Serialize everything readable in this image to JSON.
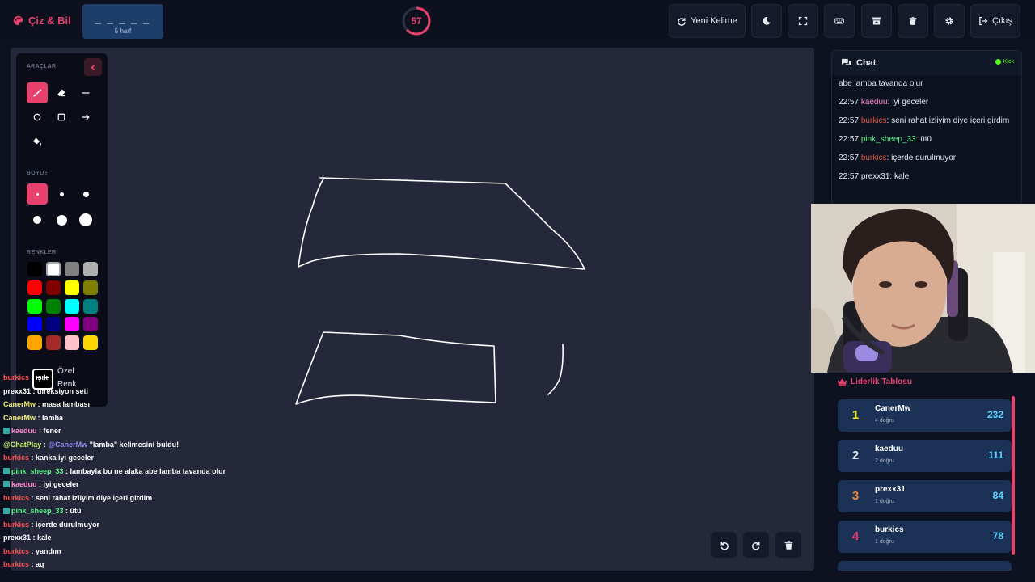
{
  "header": {
    "brand": "Çiz & Bil",
    "word_mask": "_ _ _ _ _",
    "word_length": "5 harf",
    "timer": "57",
    "timer_fraction": 0.63,
    "new_word_label": "Yeni Kelime",
    "exit_label": "Çıkış"
  },
  "tools": {
    "tools_title": "ARAÇLAR",
    "size_title": "BOYUT",
    "colors_title": "RENKLER",
    "custom_color_label_1": "Özel",
    "custom_color_label_2": "Renk",
    "colors": [
      "#000000",
      "#ffffff",
      "#808080",
      "#b0b0b0",
      "#ff0000",
      "#800000",
      "#ffff00",
      "#808000",
      "#00ff00",
      "#008000",
      "#00ffff",
      "#008080",
      "#0000ff",
      "#000080",
      "#ff00ff",
      "#800080",
      "#ffa500",
      "#a52a2a",
      "#ffc0cb",
      "#ffd700"
    ],
    "accent": "#e8416d"
  },
  "overlay_chat": [
    {
      "user": "burkics",
      "color": "#ff4d4d",
      "text": "ışık",
      "badge": false
    },
    {
      "user": "prexx31",
      "color": "#ffffff",
      "text": "direksiyon seti",
      "badge": false
    },
    {
      "user": "CanerMw",
      "color": "#f0f07a",
      "text": "masa lambası",
      "badge": false
    },
    {
      "user": "CanerMw",
      "color": "#f0f07a",
      "text": "lamba",
      "badge": false
    },
    {
      "user": "kaeduu",
      "color": "#ff8ad0",
      "text": "fener",
      "badge": true
    },
    {
      "user": "@ChatPlay",
      "color": "#c6f36b",
      "text": "\"lamba\" kelimesini buldu!",
      "mention": "@CanerMw",
      "badge": false
    },
    {
      "user": "burkics",
      "color": "#ff4d4d",
      "text": "kanka iyi geceler",
      "badge": false
    },
    {
      "user": "pink_sheep_33",
      "color": "#5df08a",
      "text": "lambayla bu ne alaka abe lamba tavanda olur",
      "badge": true
    },
    {
      "user": "kaeduu",
      "color": "#ff8ad0",
      "text": "iyi geceler",
      "badge": true
    },
    {
      "user": "burkics",
      "color": "#ff4d4d",
      "text": "seni rahat izliyim diye içeri girdim",
      "badge": false
    },
    {
      "user": "pink_sheep_33",
      "color": "#5df08a",
      "text": "ütü",
      "badge": true
    },
    {
      "user": "burkics",
      "color": "#ff4d4d",
      "text": "içerde durulmuyor",
      "badge": false
    },
    {
      "user": "prexx31",
      "color": "#ffffff",
      "text": "kale",
      "badge": false
    },
    {
      "user": "burkics",
      "color": "#ff4d4d",
      "text": "yandım",
      "badge": false
    },
    {
      "user": "burkics",
      "color": "#ff4d4d",
      "text": "aq",
      "badge": false
    }
  ],
  "chat": {
    "title": "Chat",
    "platform": "Kick",
    "partial_line": "abe lamba tavanda olur",
    "messages": [
      {
        "time": "22:57",
        "user": "kaeduu",
        "color": "#ff8ad0",
        "text": "iyi geceler"
      },
      {
        "time": "22:57",
        "user": "burkics",
        "color": "#e0533d",
        "text": "seni rahat izliyim diye içeri girdim"
      },
      {
        "time": "22:57",
        "user": "pink_sheep_33",
        "color": "#5df08a",
        "text": "ütü"
      },
      {
        "time": "22:57",
        "user": "burkics",
        "color": "#e0533d",
        "text": "içerde durulmuyor"
      },
      {
        "time": "22:57",
        "user": "prexx31",
        "color": "#e8ebf2",
        "text": "kale"
      }
    ]
  },
  "leaderboard": {
    "title": "Liderlik Tablosu",
    "rows": [
      {
        "rank": "1",
        "rank_color": "#f5e21e",
        "name": "CanerMw",
        "sub": "4 doğru",
        "score": "232"
      },
      {
        "rank": "2",
        "rank_color": "#d8dde6",
        "name": "kaeduu",
        "sub": "2 doğru",
        "score": "111"
      },
      {
        "rank": "3",
        "rank_color": "#e8883a",
        "name": "prexx31",
        "sub": "1 doğru",
        "score": "84"
      },
      {
        "rank": "4",
        "rank_color": "#e8416d",
        "name": "burkics",
        "sub": "1 doğru",
        "score": "78"
      }
    ]
  }
}
